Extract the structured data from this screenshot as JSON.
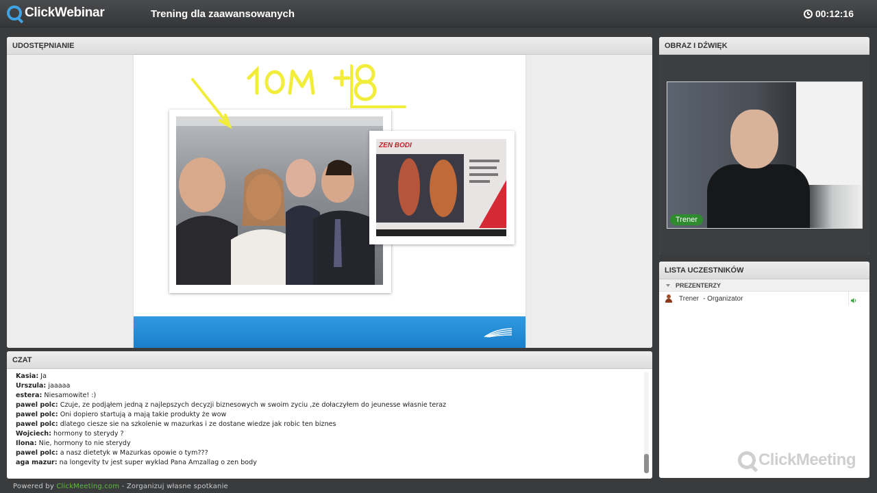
{
  "app": {
    "brand": "ClickWebinar",
    "title": "Trening dla zaawansowanych",
    "timer": "00:12:16"
  },
  "share_panel": {
    "header": "UDOSTĘPNIANIE",
    "slide_annotation": "10M +8",
    "inset_slide_title": "ZEN BODI"
  },
  "video_panel": {
    "header": "OBRAZ I DŹWIĘK",
    "camera_label": "Trener"
  },
  "participants_panel": {
    "header": "LISTA UCZESTNIKÓW",
    "group_label": "PREZENTERZY",
    "participants": [
      {
        "name": "Trener",
        "role": "- Organizator"
      }
    ],
    "watermark": "ClickMeeting"
  },
  "chat_panel": {
    "header": "CZAT",
    "messages": [
      {
        "author": "Kasia:",
        "text": "Ja"
      },
      {
        "author": "Urszula:",
        "text": "jaaaaa"
      },
      {
        "author": "estera:",
        "text": "Niesamowite! :)"
      },
      {
        "author": "pawel polc:",
        "text": "Czuje, ze podjąłem jedną z najlepszych decyzji biznesowych w swoim zyciu ,ze dołaczyłem do jeunesse własnie teraz"
      },
      {
        "author": "pawel polc:",
        "text": "Oni dopiero startują a mają takie produkty że wow"
      },
      {
        "author": "pawel polc:",
        "text": "dlatego ciesze sie na szkolenie w mazurkas i ze dostane wiedze jak robic ten biznes"
      },
      {
        "author": "Wojciech:",
        "text": "hormony to sterydy ?"
      },
      {
        "author": "Ilona:",
        "text": "Nie, hormony to nie sterydy"
      },
      {
        "author": "pawel polc:",
        "text": "a nasz dietetyk w Mazurkas opowie o tym???"
      },
      {
        "author": "aga mazur:",
        "text": "na longevity tv jest super wyklad Pana Amzallag o zen body"
      }
    ]
  },
  "footer": {
    "prefix": "Powered by",
    "link": "ClickMeeting.com",
    "suffix": "- Zorganizuj własne spotkanie"
  }
}
